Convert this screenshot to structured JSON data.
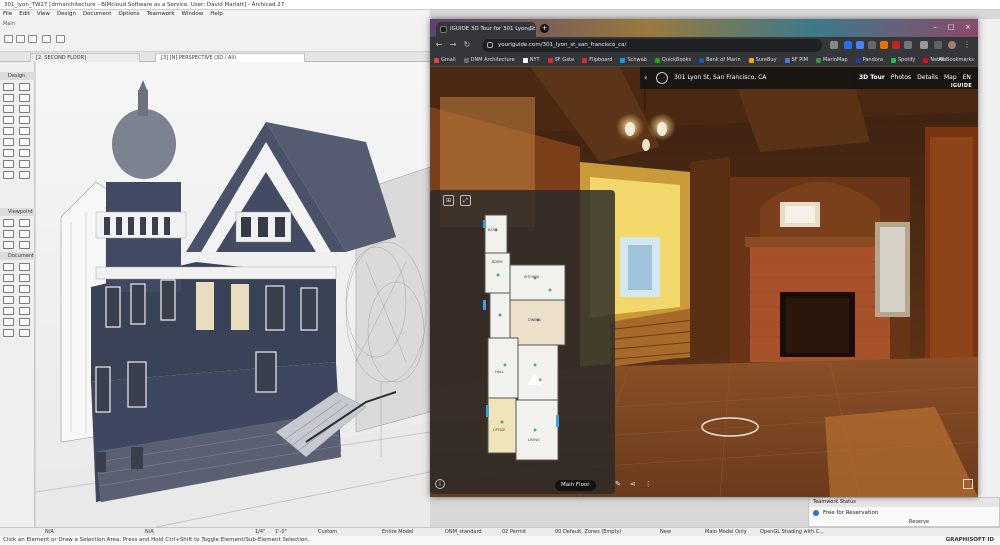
{
  "archicad": {
    "title": "301_lyon_TW27 [drmarchitecture - BIMcloud Software as a Service, User: David Marlatt] - Archicad 27",
    "menu": [
      "File",
      "Edit",
      "View",
      "Design",
      "Document",
      "Options",
      "Teamwork",
      "Window",
      "Help"
    ],
    "toolbar_label": "Main",
    "tabs": [
      "[2. SECOND FLOOR]",
      "[3] [N] PERSPECTIVE (3D / All)"
    ],
    "toolbox": {
      "design_label": "Design",
      "viewpoint_label": "Viewpoint",
      "document_label": "Document"
    },
    "status": [
      "N/A",
      "N/A",
      "1/4\"",
      "1'-0\"",
      "Custom",
      "Entire Model",
      "DNM_standard",
      "02 Permit",
      "00 Default, Zones (Empty)",
      "New",
      "Main Model Only",
      "OpenGL Shading with C..."
    ],
    "hint": "Click an Element or Draw a Selection Area. Press and Hold Ctrl+Shift to Toggle Element/Sub-Element Selection.",
    "logo": "GRAPHISOFT ID",
    "teamwork": {
      "title": "Teamwork Status",
      "status": "Free for Reservation",
      "reserve": "Reserve"
    }
  },
  "browser": {
    "tab_title": "iGUIDE 3D Tour for 301 Lyon St",
    "url": "youriguide.com/301_lyon_st_san_francisco_ca/",
    "bookmarks": [
      {
        "label": "Gmail",
        "color": "#ea4335"
      },
      {
        "label": "DNM Architecture",
        "color": "#6b6b6b"
      },
      {
        "label": "NYT",
        "color": "#ffffff"
      },
      {
        "label": "SF Gate",
        "color": "#d93025"
      },
      {
        "label": "Flipboard",
        "color": "#e12828"
      },
      {
        "label": "Schwab",
        "color": "#00a0df"
      },
      {
        "label": "QuickBooks",
        "color": "#2ca01c"
      },
      {
        "label": "Bank of Marin",
        "color": "#1a5aa0"
      },
      {
        "label": "SureBuy",
        "color": "#f2a900"
      },
      {
        "label": "SF PIM",
        "color": "#4a7bd0"
      },
      {
        "label": "MarinMap",
        "color": "#3d8f3d"
      },
      {
        "label": "Pandora",
        "color": "#224099"
      },
      {
        "label": "Spotify",
        "color": "#1db954"
      },
      {
        "label": "Netflix",
        "color": "#e50914"
      }
    ],
    "all_bookmarks": "All Bookmarks"
  },
  "tour": {
    "address": "301 Lyon St, San Francisco, CA",
    "nav": [
      "3D Tour",
      "Photos",
      "Details",
      "Map",
      "EN"
    ],
    "logo": "iGUIDE",
    "floor_button": "Main Floor",
    "rooms": {
      "kitchen": "KITCHEN",
      "dining": "DINING",
      "living": "LIVING",
      "office": "OFFICE",
      "hall": "HALL",
      "bedroom": "BDRM",
      "bath": "BATH"
    }
  }
}
